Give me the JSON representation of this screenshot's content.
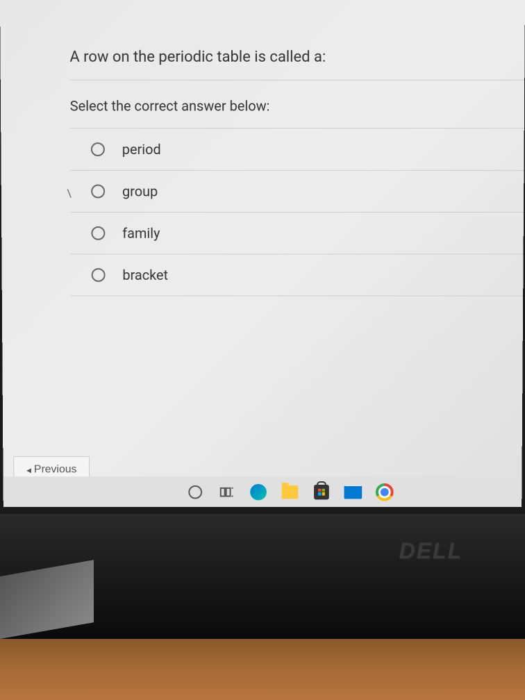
{
  "quiz": {
    "question": "A row on the periodic table is called a:",
    "instruction": "Select the correct answer below:",
    "options": [
      {
        "label": "period"
      },
      {
        "label": "group"
      },
      {
        "label": "family"
      },
      {
        "label": "bracket"
      }
    ]
  },
  "navigation": {
    "previous_label": "Previous"
  },
  "hardware": {
    "brand": "DELL"
  },
  "artifact": {
    "backslash": "\\"
  }
}
